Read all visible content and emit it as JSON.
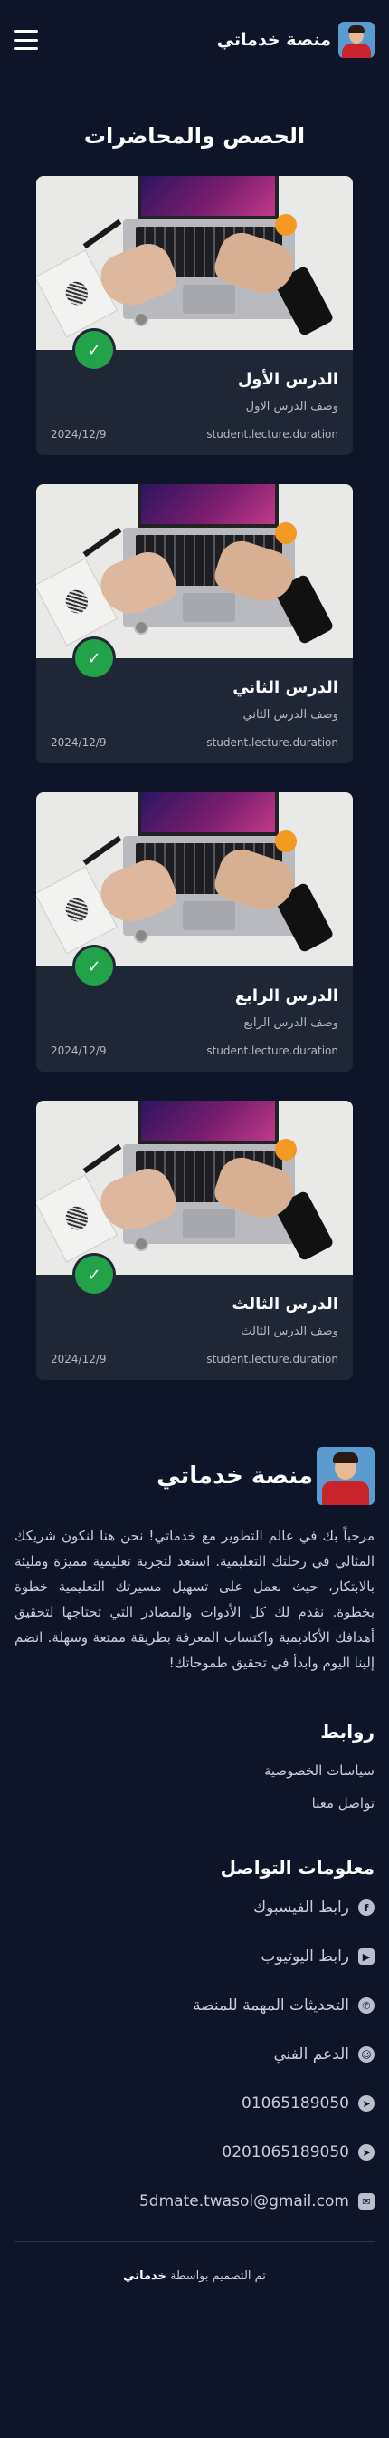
{
  "header": {
    "brand_title": "منصة خدماتي"
  },
  "section_title": "الحصص والمحاضرات",
  "lectures": [
    {
      "title": "الدرس الأول",
      "description": "وصف الدرس الاول",
      "duration": "student.lecture.duration",
      "date": "2024/12/9"
    },
    {
      "title": "الدرس الثاني",
      "description": "وصف الدرس الثاني",
      "duration": "student.lecture.duration",
      "date": "2024/12/9"
    },
    {
      "title": "الدرس الرابع",
      "description": "وصف الدرس الرابع",
      "duration": "student.lecture.duration",
      "date": "2024/12/9"
    },
    {
      "title": "الدرس الثالث",
      "description": "وصف الدرس الثالث",
      "duration": "student.lecture.duration",
      "date": "2024/12/9"
    }
  ],
  "footer": {
    "brand_title": "منصة خدماتي",
    "about": "مرحباً بك في عالم التطوير مع خدماتي! نحن هنا لنكون شريكك المثالي في رحلتك التعليمية. استعد لتجربة تعليمية مميزة ومليئة بالابتكار، حيث نعمل على تسهيل مسيرتك التعليمية خطوة بخطوة. نقدم لك كل الأدوات والمصادر التي تحتاجها لتحقيق أهدافك الأكاديمية واكتساب المعرفة بطريقة ممتعة وسهلة. انضم إلينا اليوم وابدأ في تحقيق طموحاتك!",
    "links_heading": "روابط",
    "links": [
      "سياسات الخصوصية",
      "تواصل معنا"
    ],
    "contact_heading": "معلومات التواصل",
    "contacts": [
      {
        "icon": "facebook-icon",
        "glyph": "f",
        "label": "رابط الفيسبوك"
      },
      {
        "icon": "youtube-icon",
        "glyph": "▶",
        "label": "رابط اليوتيوب"
      },
      {
        "icon": "whatsapp-icon",
        "glyph": "✆",
        "label": "التحديثات المهمة للمنصة"
      },
      {
        "icon": "support-icon",
        "glyph": "☺",
        "label": "الدعم الفني"
      },
      {
        "icon": "telegram-icon",
        "glyph": "➤",
        "label": "01065189050"
      },
      {
        "icon": "telegram-icon",
        "glyph": "➤",
        "label": "0201065189050"
      },
      {
        "icon": "email-icon",
        "glyph": "✉",
        "label": "5dmate.twasol@gmail.com"
      }
    ],
    "copyright_prefix": "تم التصميم بواسطة",
    "copyright_name": "خدماتي"
  }
}
